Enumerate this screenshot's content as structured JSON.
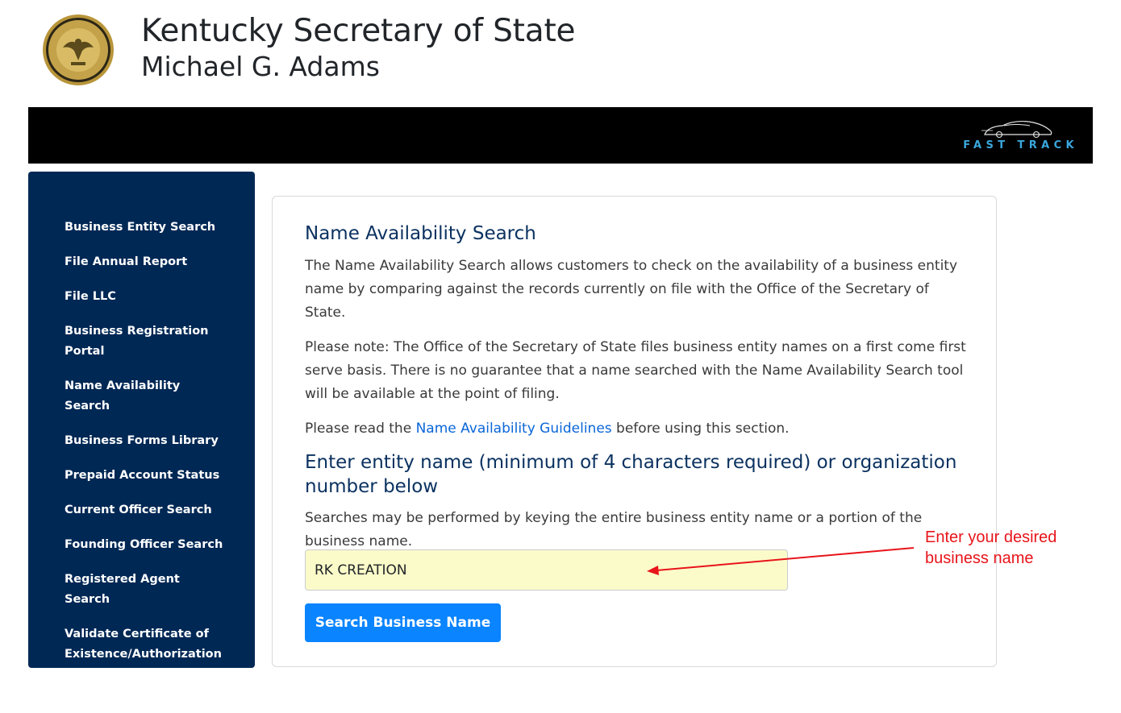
{
  "header": {
    "title": "Kentucky Secretary of State",
    "subtitle": "Michael G. Adams",
    "seal_icon": "state-seal-icon",
    "fast_track": "FAST TRACK"
  },
  "colors": {
    "sidebar_bg": "#002855",
    "heading": "#0b3260",
    "link": "#0a66d8",
    "button": "#0a84ff",
    "input_bg": "#fbfbc9",
    "annotation": "#e8141a",
    "fast_track": "#3aa7dc"
  },
  "sidebar": {
    "items": [
      {
        "label": "Business Entity Search"
      },
      {
        "label": "File Annual Report"
      },
      {
        "label": "File LLC"
      },
      {
        "label": "Business Registration Portal"
      },
      {
        "label": "Name Availability Search"
      },
      {
        "label": "Business Forms Library"
      },
      {
        "label": "Prepaid Account Status"
      },
      {
        "label": "Current Officer Search"
      },
      {
        "label": "Founding Officer Search"
      },
      {
        "label": "Registered Agent Search"
      },
      {
        "label": "Validate Certificate of Existence/Authorization"
      }
    ]
  },
  "main": {
    "title": "Name Availability Search",
    "intro": "The Name Availability Search allows customers to check on the availability of a business entity name by comparing against the records currently on file with the Office of the Secretary of State.",
    "note": "Please note: The Office of the Secretary of State files business entity names on a first come first serve basis. There is no guarantee that a name searched with the Name Availability Search tool will be available at the point of filing.",
    "guidelines_prefix": "Please read the ",
    "guidelines_link": "Name Availability Guidelines",
    "guidelines_suffix": " before using this section.",
    "subtitle": "Enter entity name (minimum of 4 characters required) or organization number below",
    "help": "Searches may be performed by keying the entire business entity name or a portion of the business name.",
    "search_value": "RK CREATION",
    "search_button": "Search Business Name"
  },
  "annotation": {
    "text": "Enter your desired business name"
  }
}
